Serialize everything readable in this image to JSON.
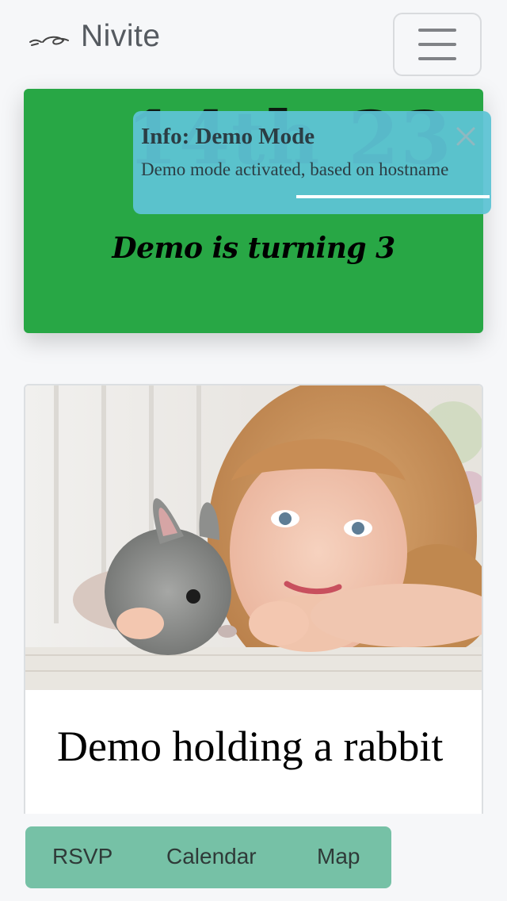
{
  "header": {
    "brand": "Nivite",
    "menu_toggle": "menu"
  },
  "hero": {
    "big_text": "14th 23",
    "subtitle": "Demo is turning 3",
    "color": "#28a745"
  },
  "toast": {
    "title": "Info: Demo Mode",
    "message": "Demo mode activated, based on hostname",
    "color": "#5dc3d5",
    "close_icon": "close-icon"
  },
  "card": {
    "photo_alt": "Girl holding a rabbit",
    "title": "Demo holding a rabbit"
  },
  "bottom_nav": {
    "items": [
      {
        "label": "RSVP"
      },
      {
        "label": "Calendar"
      },
      {
        "label": "Map"
      }
    ],
    "color": "#76c1a6"
  }
}
